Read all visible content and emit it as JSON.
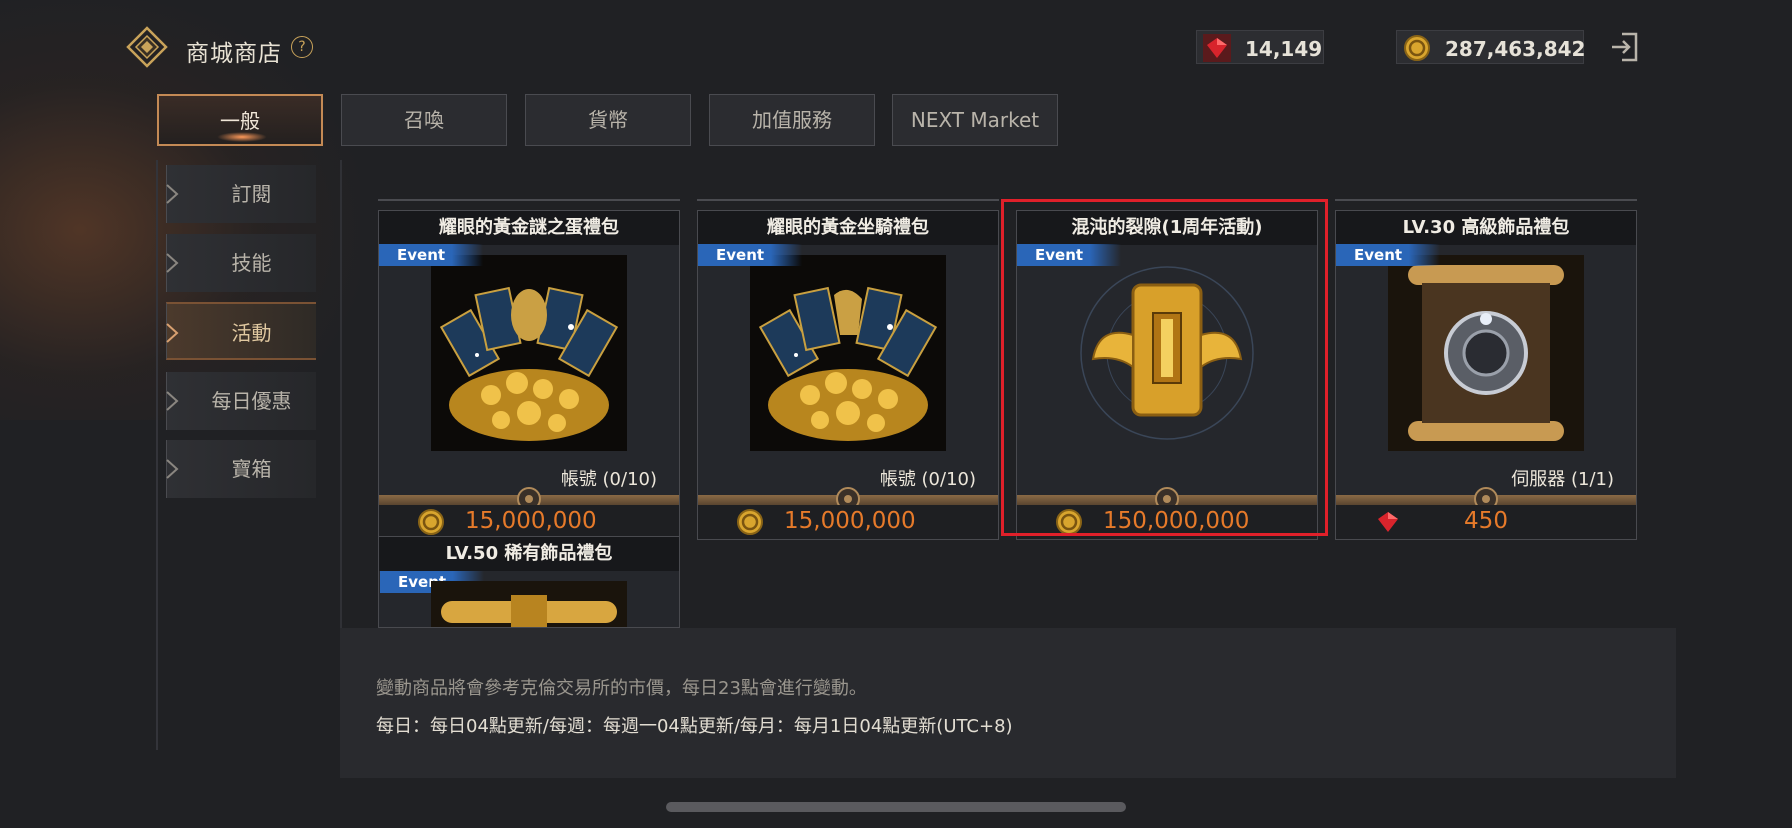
{
  "header": {
    "title": "商城商店",
    "help_glyph": "?",
    "gems": "14,149",
    "gold": "287,463,842"
  },
  "tabs": [
    {
      "label": "一般",
      "active": true
    },
    {
      "label": "召喚",
      "active": false
    },
    {
      "label": "貨幣",
      "active": false
    },
    {
      "label": "加值服務",
      "active": false
    },
    {
      "label": "NEXT Market",
      "active": false
    }
  ],
  "sidebar": [
    {
      "label": "訂閱",
      "active": false
    },
    {
      "label": "技能",
      "active": false
    },
    {
      "label": "活動",
      "active": true
    },
    {
      "label": "每日優惠",
      "active": false
    },
    {
      "label": "寶箱",
      "active": false
    }
  ],
  "products": [
    {
      "name": "耀眼的黃金謎之蛋禮包",
      "badge": "Event",
      "limit": "帳號 (0/10)",
      "price": "15,000,000",
      "currency": "gold-coin-icon",
      "art": "golden-egg-cards-art"
    },
    {
      "name": "耀眼的黃金坐騎禮包",
      "badge": "Event",
      "limit": "帳號 (0/10)",
      "price": "15,000,000",
      "currency": "gold-coin-icon",
      "art": "golden-mount-cards-art"
    },
    {
      "name": "混沌的裂隙(1周年活動)",
      "badge": "Event",
      "limit": "",
      "price": "150,000,000",
      "currency": "gold-coin-icon",
      "art": "anniversary-scroll-art",
      "highlighted": true
    },
    {
      "name": "LV.30 高級飾品禮包",
      "badge": "Event",
      "limit": "伺服器 (1/1)",
      "price": "450",
      "currency": "red-gem-icon",
      "art": "accessory-scroll-art"
    },
    {
      "name": "LV.50 稀有飾品禮包",
      "badge": "Event",
      "limit": "",
      "price": "",
      "currency": "",
      "art": "rare-scroll-art"
    }
  ],
  "footer": {
    "line1": "變動商品將會參考克倫交易所的市價，每日23點會進行變動。",
    "line2": "每日：每日04點更新/每週：每週一04點更新/每月：每月1日04點更新(UTC+8)"
  },
  "colors": {
    "accent": "#c48a55",
    "price": "#e67a2a",
    "event_badge": "#2a66b8",
    "highlight": "#e0202a"
  }
}
